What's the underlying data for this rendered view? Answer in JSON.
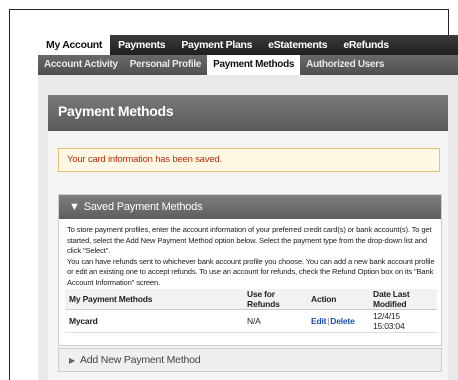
{
  "tabs_primary": [
    {
      "label": "My Account",
      "active": true
    },
    {
      "label": "Payments",
      "active": false
    },
    {
      "label": "Payment Plans",
      "active": false
    },
    {
      "label": "eStatements",
      "active": false
    },
    {
      "label": "eRefunds",
      "active": false
    }
  ],
  "tabs_secondary": [
    {
      "label": "Account Activity",
      "active": false
    },
    {
      "label": "Personal Profile",
      "active": false
    },
    {
      "label": "Payment Methods",
      "active": true
    },
    {
      "label": "Authorized Users",
      "active": false
    }
  ],
  "page": {
    "title": "Payment Methods"
  },
  "alert": {
    "message": "Your card information has been saved."
  },
  "saved_section": {
    "title": "Saved Payment Methods",
    "toggle_icon": "triangle-down",
    "instructions": "To store payment profiles, enter the account information of your preferred credit card(s) or bank account(s). To get started, select the Add New Payment Method option below. Select the payment type from the drop-down list and click \"Select\".",
    "instructions2": "You can have refunds sent to whichever bank account profile you choose. You can add a new bank account profile or edit an existing one to accept refunds. To use an account for refunds, check the Refund Option box on its \"Bank Account Information\" screen.",
    "table": {
      "headers": [
        "My Payment Methods",
        "Use for Refunds",
        "Action",
        "Date Last Modified"
      ],
      "rows": [
        {
          "name": "Mycard",
          "refunds": "N/A",
          "edit": "Edit",
          "delete": "Delete",
          "date": "12/4/15 15:03:04"
        }
      ]
    }
  },
  "add_section": {
    "title": "Add New Payment Method",
    "toggle_icon": "triangle-right"
  },
  "colors": {
    "alert_text": "#b03010",
    "link": "#1a4ea8",
    "alert_border": "#e6c36a"
  }
}
